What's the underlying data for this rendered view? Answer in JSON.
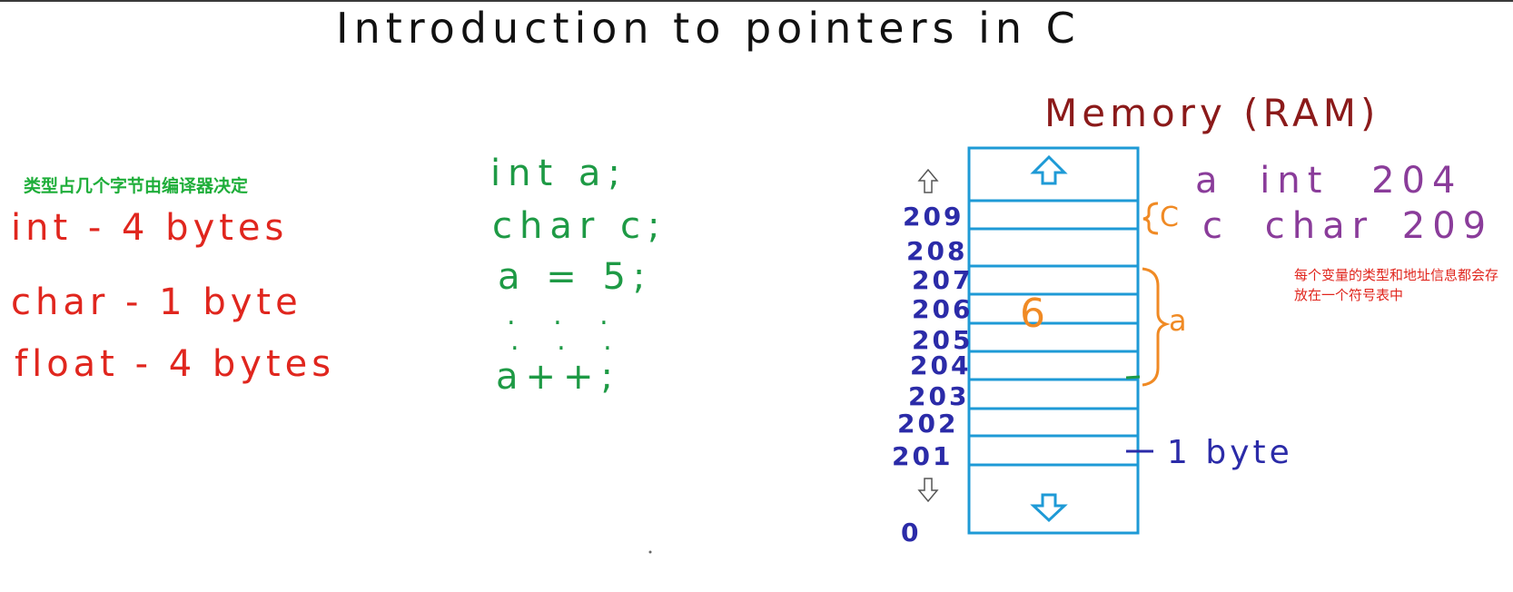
{
  "title": "Introduction to pointers in C",
  "memory": {
    "title": "Memory (RAM)",
    "byte_label": "1 byte",
    "brace_c_label": "C",
    "brace_a_label": "a",
    "stored_value": "6",
    "addresses": [
      "209",
      "208",
      "207",
      "206",
      "205",
      "204",
      "203",
      "202",
      "201",
      "0"
    ]
  },
  "sizes": {
    "note": "类型占几个字节由编译器决定",
    "lines": [
      "int - 4 bytes",
      "char - 1 byte",
      "float - 4 bytes"
    ]
  },
  "code": {
    "lines": [
      "int a;",
      "char c;",
      "a = 5;",
      ". . .",
      ". . .",
      "a++;"
    ]
  },
  "symbol_table": {
    "rows": [
      {
        "name": "a",
        "type": "int",
        "address": "204"
      },
      {
        "name": "c",
        "type": "char",
        "address": "209"
      }
    ],
    "note": "每个变量的类型和地址信息都会存放在一个符号表中"
  },
  "colors": {
    "memory_box": "#1e9ad6",
    "brace": "#f08a24",
    "address": "#2b2ba8",
    "code": "#1e9a45",
    "sizes": "#e0261e",
    "symbol_table": "#8a3c9a",
    "memory_title": "#8b1a1a"
  }
}
